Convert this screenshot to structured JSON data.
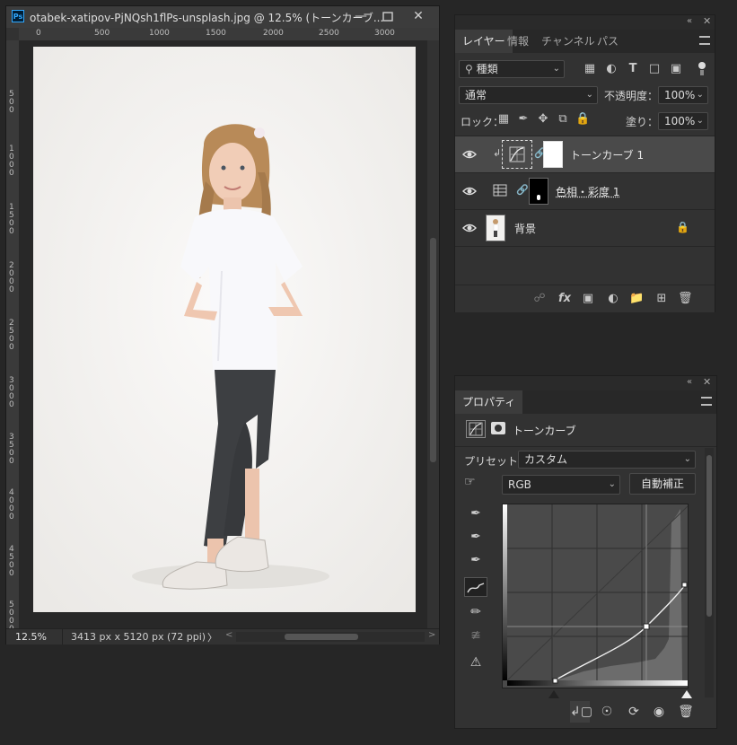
{
  "document": {
    "title": "otabek-xatipov-PjNQsh1flPs-unsplash.jpg @ 12.5% (トーンカーブ...",
    "app_icon": "Ps",
    "ruler_top_labels": [
      "0",
      "500",
      "1000",
      "1500",
      "2000",
      "2500",
      "3000"
    ],
    "ruler_left_labels": [
      "5\n0\n0",
      "1\n0\n0\n0",
      "1\n5\n0\n0",
      "2\n0\n0\n0",
      "2\n5\n0\n0",
      "3\n0\n0\n0",
      "3\n5\n0\n0",
      "4\n0\n0\n0",
      "4\n5\n0\n0",
      "5\n0\n0\n0"
    ],
    "zoom": "12.5%",
    "image_info": "3413 px x 5120 px (72 ppi)",
    "status_arrow": "〉"
  },
  "layers_panel": {
    "tabs": [
      "レイヤー",
      "情報",
      "チャンネル",
      "パス"
    ],
    "filter_kind": "種類",
    "blend_mode": "通常",
    "opacity_label": "不透明度：",
    "opacity_value": "100%",
    "lock_label": "ロック：",
    "fill_label": "塗り：",
    "fill_value": "100%",
    "layers": [
      {
        "name": "トーンカーブ 1",
        "selected": true
      },
      {
        "name": "色相・彩度 1",
        "selected": false
      },
      {
        "name": "背景",
        "selected": false
      }
    ]
  },
  "properties_panel": {
    "tab": "プロパティ",
    "adjustment_title": "トーンカーブ",
    "preset_label": "プリセット：",
    "preset_value": "カスタム",
    "channel_value": "RGB",
    "auto_button": "自動補正"
  },
  "colors": {
    "bg": "#262626",
    "panel": "#323232",
    "selected_layer": "#4a4a4a",
    "photo_bg": "#f4f3f1"
  }
}
